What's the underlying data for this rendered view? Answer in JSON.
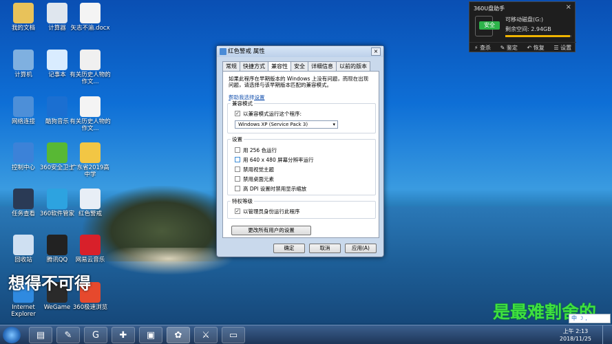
{
  "desktop": {
    "icons": [
      {
        "label": "我的文档",
        "icon": "folder-icon",
        "color": "#e8c25a"
      },
      {
        "label": "计算器",
        "icon": "calculator-icon",
        "color": "#dfe6ee"
      },
      {
        "label": "矢志不渝.docx",
        "icon": "document-icon",
        "color": "#f4f4f4"
      },
      {
        "label": "计算机",
        "icon": "computer-icon",
        "color": "#7fb0e0"
      },
      {
        "label": "记事本",
        "icon": "notepad-icon",
        "color": "#d9ecff"
      },
      {
        "label": "有关历史人物的作文...",
        "icon": "pdf-icon",
        "color": "#f0f0f0"
      },
      {
        "label": "网络连接",
        "icon": "network-icon",
        "color": "#4d8fd8"
      },
      {
        "label": "酷狗音乐",
        "icon": "kugou-icon",
        "color": "#1b6fd1"
      },
      {
        "label": "有关历史人物的作文...",
        "icon": "document-icon",
        "color": "#f4f4f4"
      },
      {
        "label": "控制中心",
        "icon": "control-center-icon",
        "color": "#3c82d8"
      },
      {
        "label": "360安全卫士",
        "icon": "360-security-icon",
        "color": "#58b834"
      },
      {
        "label": "广东省2019高中学",
        "icon": "image-icon",
        "color": "#f2c644"
      },
      {
        "label": "任务查看",
        "icon": "task-view-icon",
        "color": "#2a3a55"
      },
      {
        "label": "360软件管家",
        "icon": "360-software-icon",
        "color": "#2da3e0"
      },
      {
        "label": "红色警戒",
        "icon": "red-alert-icon",
        "color": "#e8eef6"
      },
      {
        "label": "回收站",
        "icon": "recycle-bin-icon",
        "color": "#cfe0f2"
      },
      {
        "label": "腾讯QQ",
        "icon": "qq-icon",
        "color": "#222222"
      },
      {
        "label": "网易云音乐",
        "icon": "netease-music-icon",
        "color": "#d8202a"
      },
      {
        "label": "Internet Explorer",
        "icon": "ie-icon",
        "color": "#2f8ae0"
      },
      {
        "label": "WeGame",
        "icon": "wegame-icon",
        "color": "#2a2a2a"
      },
      {
        "label": "360极速浏览",
        "icon": "360-browser-icon",
        "color": "#e6492d"
      }
    ],
    "overlay_left": "想得不可得",
    "overlay_right": "是最难割舍的"
  },
  "widget": {
    "title": "360U盘助手",
    "safe_label": "安全",
    "drive_label": "可移动磁盘(G:)",
    "free_label": "剩余空间: 2.94GB",
    "usage_fraction": 0.98,
    "actions": [
      "查杀",
      "鉴定",
      "恢复",
      "设置"
    ],
    "close": "×"
  },
  "dialog": {
    "title": "红色警戒 属性",
    "close": "×",
    "tabs": [
      "常规",
      "快捷方式",
      "兼容性",
      "安全",
      "详细信息",
      "以前的版本"
    ],
    "active_tab": 2,
    "intro": "如果此程序在早期版本的 Windows 上没有问题，而现在出现问题，请选择与该早期版本匹配的兼容模式。",
    "help_link": "帮助我选择设置",
    "compat_group": "兼容模式",
    "compat_check": "以兼容模式运行这个程序:",
    "compat_value": "Windows XP (Service Pack 3)",
    "settings_group": "设置",
    "settings": [
      "用 256 色运行",
      "用 640 x 480 屏幕分辨率运行",
      "禁用视觉主题",
      "禁用桌面元素",
      "高 DPI 设置时禁用显示缩放"
    ],
    "privilege_group": "特权等级",
    "privilege_check": "以管理员身份运行此程序",
    "all_users_button": "更改所有用户的设置",
    "ok": "确定",
    "cancel": "取消",
    "apply": "应用(A)"
  },
  "taskbar": {
    "time": "上午 2:13",
    "date": "2018/11/25",
    "ime": "中 ☽ ,"
  }
}
